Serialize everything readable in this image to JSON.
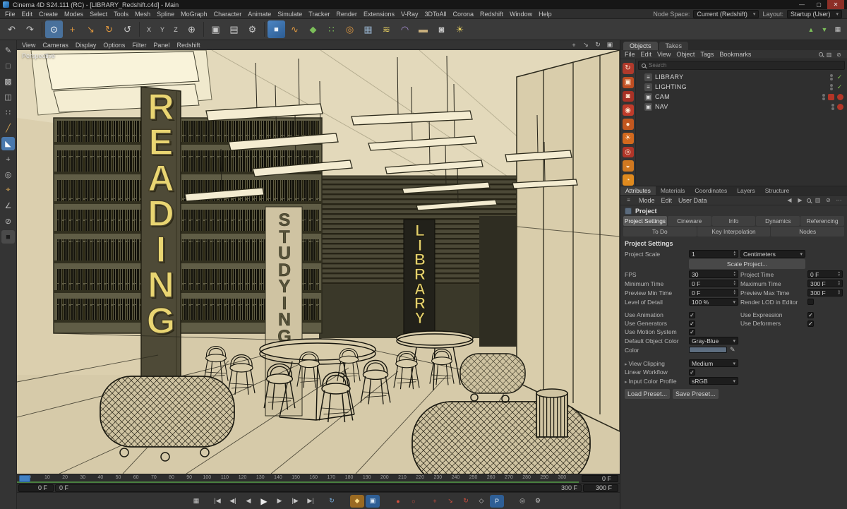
{
  "window": {
    "title": "Cinema 4D S24.111 (RC) - [LIBRARY_Redshift.c4d] - Main",
    "minimize": "—",
    "maximize": "▢",
    "close": "✕"
  },
  "menubar": {
    "items": [
      "File",
      "Edit",
      "Create",
      "Modes",
      "Select",
      "Tools",
      "Mesh",
      "Spline",
      "MoGraph",
      "Character",
      "Animate",
      "Simulate",
      "Tracker",
      "Render",
      "Extensions",
      "V-Ray",
      "3DToAll",
      "Corona",
      "Redshift",
      "Window",
      "Help"
    ]
  },
  "topbar": {
    "node_space_label": "Node Space:",
    "node_space_value": "Current (Redshift)",
    "layout_label": "Layout:",
    "layout_value": "Startup (User)"
  },
  "toolbar": {
    "undo": "↶",
    "redo": "↷",
    "live_selection": "⊙",
    "move": "+",
    "scale": "↘",
    "rotate": "↻",
    "last_tool": "↺",
    "lock_x": "X",
    "lock_y": "Y",
    "lock_z": "Z",
    "coord_system": "⊕",
    "render_view": "▣",
    "render_pv": "▤",
    "render_settings": "⚙",
    "add_cube": "■",
    "spline_pen": "∿",
    "generators": "◆",
    "mograph": "∷",
    "dynamics": "◎",
    "volume": "▦",
    "fields": "≋",
    "deformers": "◠",
    "environment": "▬",
    "camera": "◙",
    "lights": "☀",
    "overflow_up": "▲",
    "overflow_down": "▼",
    "palette_tiles": "▦"
  },
  "leftstrip": {
    "make_editable": "✎",
    "model_mode": "□",
    "texture_mode": "▩",
    "workplane_mode": "◫",
    "points_mode": "∷",
    "edges_mode": "╱",
    "polygons_mode": "◣",
    "enable_axis": "+",
    "solo_mode": "◎",
    "snap_toggle": "⌖",
    "quantize": "∠",
    "lock_axes": "⊘",
    "display_filter": "■"
  },
  "viewport_menu": {
    "items": [
      "View",
      "Cameras",
      "Display",
      "Options",
      "Filter",
      "Panel",
      "Redshift"
    ],
    "pan": "+",
    "zoom": "↘",
    "orbit": "↻",
    "toggle": "▣"
  },
  "scene": {
    "camera_label": "Perspective",
    "texts": {
      "reading": "READING",
      "studying": "STUDYING",
      "library": "LIBRARY"
    },
    "colors": {
      "viewport_bg": "#d6caa9",
      "sign_yellow": "#e9d572"
    }
  },
  "timeline": {
    "ticks": [
      0,
      10,
      20,
      30,
      40,
      50,
      60,
      70,
      80,
      90,
      100,
      110,
      120,
      130,
      140,
      150,
      160,
      170,
      180,
      190,
      200,
      210,
      220,
      230,
      240,
      250,
      260,
      270,
      280,
      290,
      300
    ],
    "current_frame": "0 F",
    "range_start": "0 F",
    "slider_start": "0 F",
    "slider_end": "300 F",
    "range_end": "300 F"
  },
  "transport": {
    "preview": "▦",
    "goto_start": "|◀",
    "prev_key": "◀|",
    "prev_frame": "◀",
    "play": "▶",
    "next_frame": "▶",
    "next_key": "|▶",
    "goto_end": "▶|",
    "loop": "↻",
    "record_key": "◆",
    "keyframe_selection": "▣",
    "autokey": "●",
    "autokey_ring": "○",
    "rec_position": "+",
    "rec_scale": "↘",
    "rec_rotation": "↻",
    "rec_param": "◇",
    "rec_pla": "P",
    "solo": "◎",
    "settings": "⚙"
  },
  "objects_panel": {
    "tabs": [
      "Objects",
      "Takes"
    ],
    "menu": [
      "File",
      "Edit",
      "View",
      "Object",
      "Tags",
      "Bookmarks"
    ],
    "search_placeholder": "Search",
    "items": [
      {
        "label": "LIBRARY",
        "icon": "≡"
      },
      {
        "label": "LIGHTING",
        "icon": "≡"
      },
      {
        "label": "CAM",
        "icon": "▣"
      },
      {
        "label": "NAV",
        "icon": "▣"
      }
    ]
  },
  "palette_strip": {
    "rs_render": "↻",
    "rs_ipr": "▣",
    "rs_material": "◙",
    "rs_proxy": "◉",
    "rs_light": "●",
    "rs_sun": "☀",
    "rs_env": "◎",
    "rs_dome": "◒",
    "rs_portal": "◔"
  },
  "attributes": {
    "tabs": [
      "Attributes",
      "Materials",
      "Coordinates",
      "Layers",
      "Structure"
    ],
    "mode_row": [
      "Mode",
      "Edit",
      "User Data"
    ],
    "object_title": "Project",
    "tab_buttons_row1": [
      "Project Settings",
      "Cineware",
      "Info",
      "Dynamics",
      "Referencing"
    ],
    "tab_buttons_row2": [
      "To Do",
      "Key Interpolation",
      "Nodes"
    ],
    "section_title": "Project Settings",
    "check_glyph": "✓",
    "fields": {
      "project_scale_label": "Project Scale",
      "project_scale_value": "1",
      "project_scale_unit": "Centimeters",
      "scale_project_button": "Scale Project...",
      "fps_label": "FPS",
      "fps_value": "30",
      "project_time_label": "Project Time",
      "project_time_value": "0 F",
      "min_time_label": "Minimum Time",
      "min_time_value": "0 F",
      "max_time_label": "Maximum Time",
      "max_time_value": "300 F",
      "preview_min_label": "Preview Min Time",
      "preview_min_value": "0 F",
      "preview_max_label": "Preview Max Time",
      "preview_max_value": "300 F",
      "lod_label": "Level of Detail",
      "lod_value": "100 %",
      "render_lod_label": "Render LOD in Editor",
      "use_animation_label": "Use Animation",
      "use_expression_label": "Use Expression",
      "use_generators_label": "Use Generators",
      "use_deformers_label": "Use Deformers",
      "use_motion_label": "Use Motion System",
      "default_color_label": "Default Object Color",
      "default_color_value": "Gray-Blue",
      "color_label": "Color",
      "color_swatch": "#5e6e80",
      "view_clipping_label": "View Clipping",
      "view_clipping_value": "Medium",
      "linear_workflow_label": "Linear Workflow",
      "input_profile_label": "Input Color Profile",
      "input_profile_value": "sRGB",
      "load_preset": "Load Preset...",
      "save_preset": "Save Preset..."
    }
  }
}
